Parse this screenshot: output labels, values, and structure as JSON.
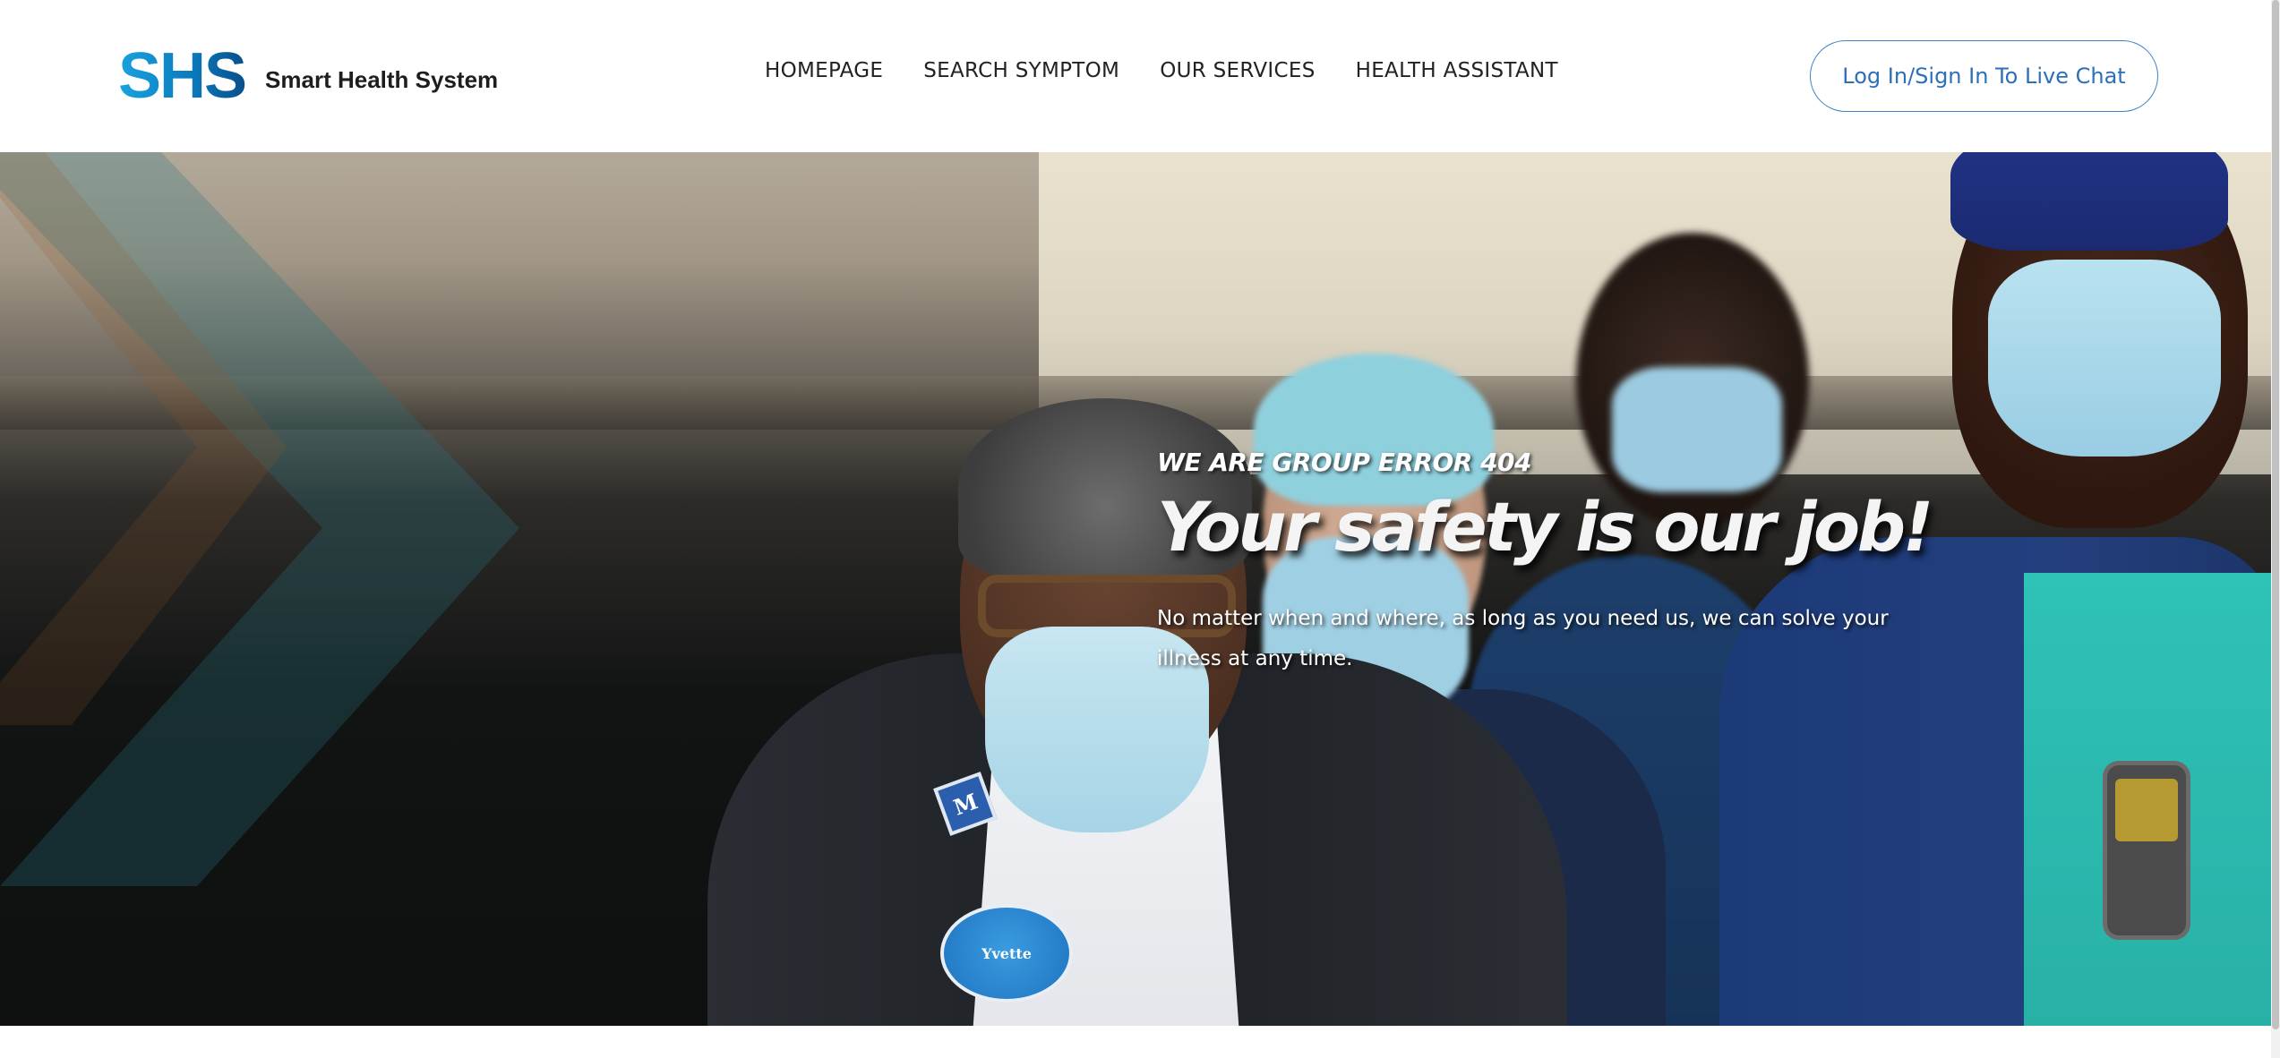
{
  "header": {
    "logo_mark": "SHS",
    "logo_text": "Smart Health System",
    "nav": [
      {
        "label": "HOMEPAGE"
      },
      {
        "label": "SEARCH SYMPTOM"
      },
      {
        "label": "OUR SERVICES"
      },
      {
        "label": "HEALTH ASSISTANT"
      }
    ],
    "login_label": "Log In/Sign In To Live Chat"
  },
  "hero": {
    "eyebrow": "WE ARE GROUP ERROR 404",
    "headline": "Your safety is our job!",
    "subtext": "No matter when and where, as long as you need us, we can solve your illness at any time.",
    "badge_name": "Yvette",
    "badge_letter": "M"
  },
  "colors": {
    "brand_blue": "#1aa3de",
    "button_border": "#3d82c4",
    "button_text": "#2d6fb8"
  }
}
